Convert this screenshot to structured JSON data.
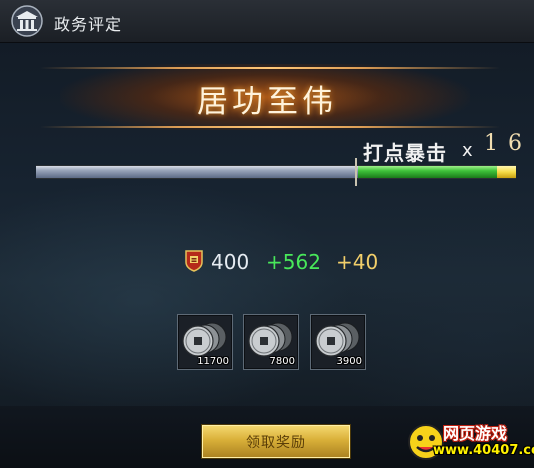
{
  "window": {
    "title": "政务评定",
    "icon": "palace-icon"
  },
  "banner": {
    "title": "居功至伟"
  },
  "crit": {
    "label": "打点暴击",
    "multiplier_symbol": "x",
    "count": "16"
  },
  "progress": {
    "base_fraction": 0.67,
    "bonus_fraction": 0.29,
    "extra_fraction": 0.04
  },
  "stats": {
    "icon": "rank-shield-icon",
    "base": "400",
    "bonus": "+562",
    "extra": "+40"
  },
  "rewards": [
    {
      "icon": "copper-coins-icon",
      "count": "11700"
    },
    {
      "icon": "copper-coins-icon",
      "count": "7800"
    },
    {
      "icon": "copper-coins-icon",
      "count": "3900"
    }
  ],
  "claim_button": {
    "label": "领取奖励"
  },
  "watermark": {
    "text": "网页游戏",
    "url": "www.40407.com"
  },
  "colors": {
    "accent_gold": "#d9b039",
    "bonus_green": "#48e85a",
    "extra_yellow": "#f2cf6a",
    "banner_orange": "#c46014"
  }
}
